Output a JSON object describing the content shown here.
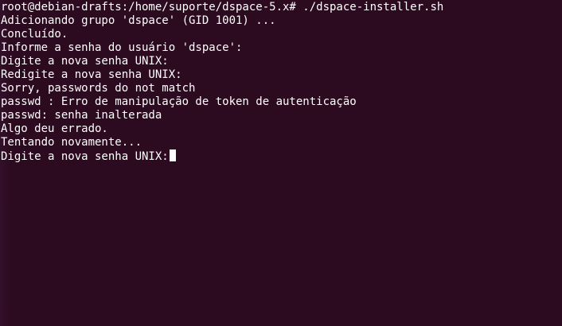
{
  "terminal": {
    "lines": [
      "root@debian-drafts:/home/suporte/dspace-5.x# ./dspace-installer.sh",
      "Adicionando grupo 'dspace' (GID 1001) ...",
      "Concluído.",
      "Informe a senha do usuário 'dspace':",
      "Digite a nova senha UNIX:",
      "Redigite a nova senha UNIX:",
      "Sorry, passwords do not match",
      "passwd : Erro de manipulação de token de autenticação",
      "passwd: senha inalterada",
      "Algo deu errado.",
      "Tentando novamente...",
      "Digite a nova senha UNIX:"
    ]
  },
  "colors": {
    "background": "#2c0a1f",
    "foreground": "#ffffff"
  }
}
